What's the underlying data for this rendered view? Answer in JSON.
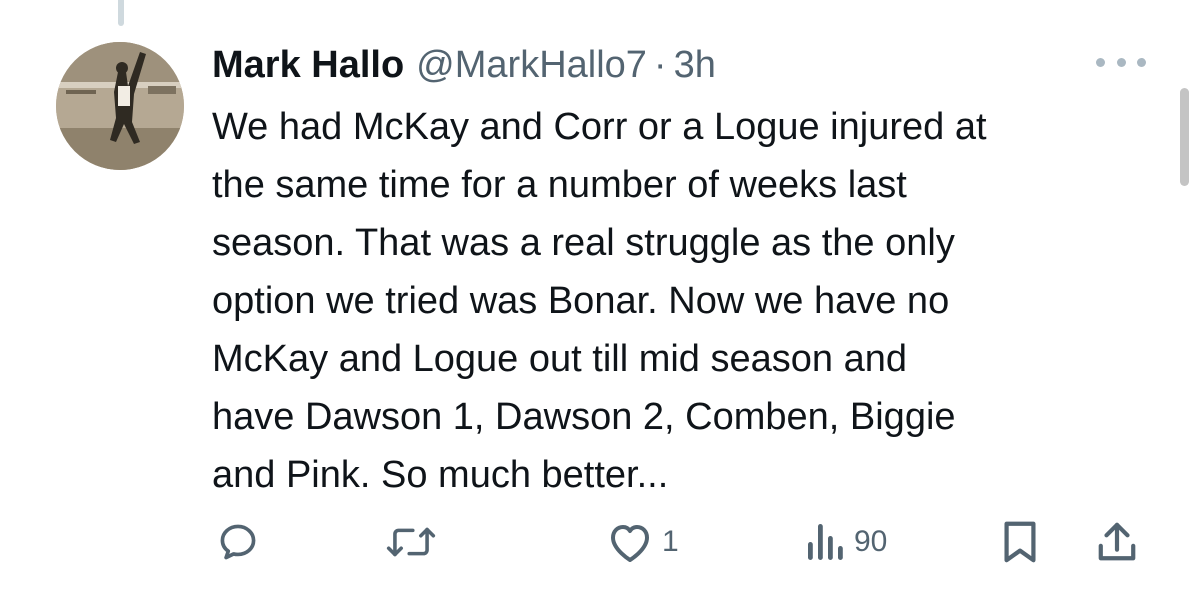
{
  "tweet": {
    "author_name": "Mark Hallo",
    "handle": "@MarkHallo7",
    "separator": "·",
    "time": "3h",
    "lines": [
      "We had McKay and Corr or a Logue injured at",
      "the same time for a number of weeks last",
      "season. That was a real struggle as the only",
      "option we tried was Bonar. Now we have no",
      "McKay and Logue out till mid season and",
      "have Dawson 1, Dawson 2, Comben, Biggie",
      "and Pink. So much better..."
    ]
  },
  "actions": {
    "reply": {
      "icon": "reply-icon"
    },
    "retweet": {
      "icon": "retweet-icon"
    },
    "like": {
      "icon": "heart-icon",
      "count": "1"
    },
    "views": {
      "icon": "views-icon",
      "count": "90"
    },
    "bookmark": {
      "icon": "bookmark-icon"
    },
    "share": {
      "icon": "share-icon"
    }
  },
  "colors": {
    "text_primary": "#0f1419",
    "text_secondary": "#536471",
    "thread_line": "#cfd9de"
  }
}
